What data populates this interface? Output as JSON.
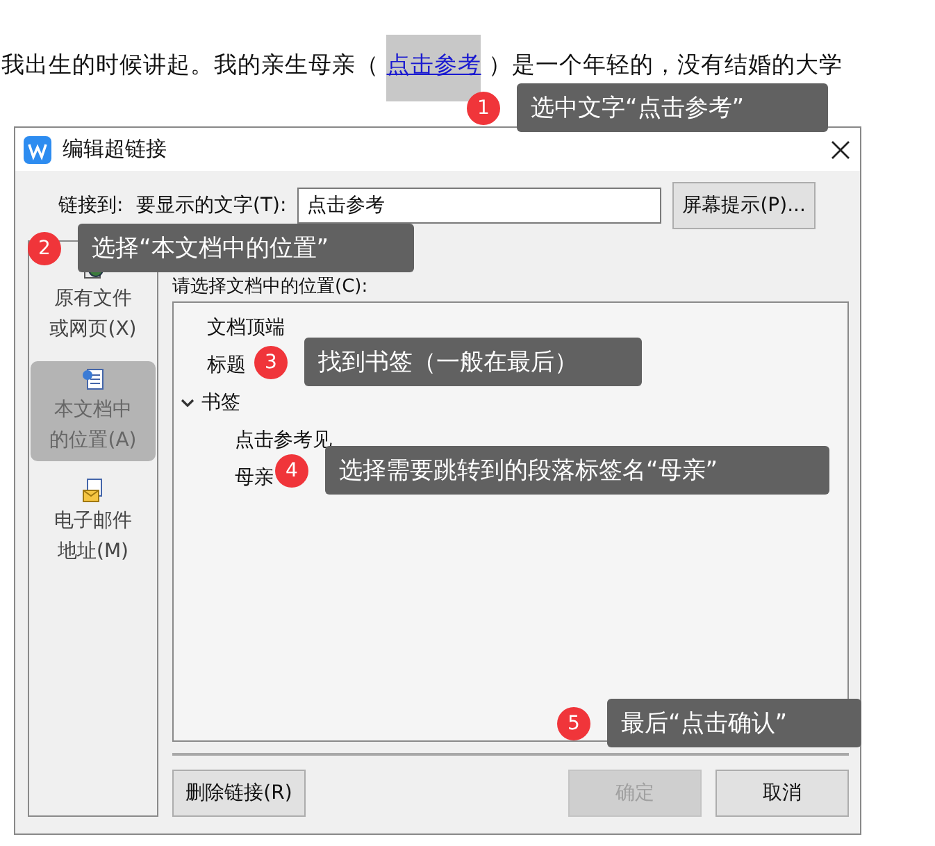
{
  "document": {
    "text_before": "我出生的时候讲起。我的亲生母亲（",
    "link": "点击参考",
    "link_selected": true,
    "text_after": "）是一个年轻的，没有结婚的大学"
  },
  "dialog": {
    "title": "编辑超链接",
    "link_to_label": "链接到:",
    "display_text_label": "要显示的文字(T):",
    "display_text_value": "点击参考",
    "screentip_button": "屏幕提示(P)...",
    "sidebar": [
      {
        "kind": "file",
        "lines": [
          "原有文件",
          "或网页(X)"
        ],
        "selected": false
      },
      {
        "kind": "document",
        "lines": [
          "本文档中",
          "的位置(A)"
        ],
        "selected": true
      },
      {
        "kind": "email",
        "lines": [
          "电子邮件",
          "地址(M)"
        ],
        "selected": false
      }
    ],
    "location_label": "请选择文档中的位置(C):",
    "tree": [
      {
        "label": "文档顶端"
      },
      {
        "label": "标题"
      },
      {
        "label": "书签",
        "expanded": true,
        "children": [
          {
            "label": "点击参考见"
          },
          {
            "label": "母亲"
          }
        ]
      }
    ],
    "buttons": [
      {
        "label": "删除链接(R)",
        "disabled": false
      },
      {
        "label": "确定",
        "disabled": true
      },
      {
        "label": "取消",
        "disabled": false
      }
    ]
  },
  "callouts": [
    {
      "number": "1",
      "text": "选中文字“点击参考”"
    },
    {
      "number": "2",
      "text": "选择“本文档中的位置”"
    },
    {
      "number": "3",
      "text": "找到书签（一般在最后）"
    },
    {
      "number": "4",
      "text": "选择需要跳转到的段落标签名“母亲”"
    },
    {
      "number": "5",
      "text": "最后“点击确认”"
    }
  ]
}
